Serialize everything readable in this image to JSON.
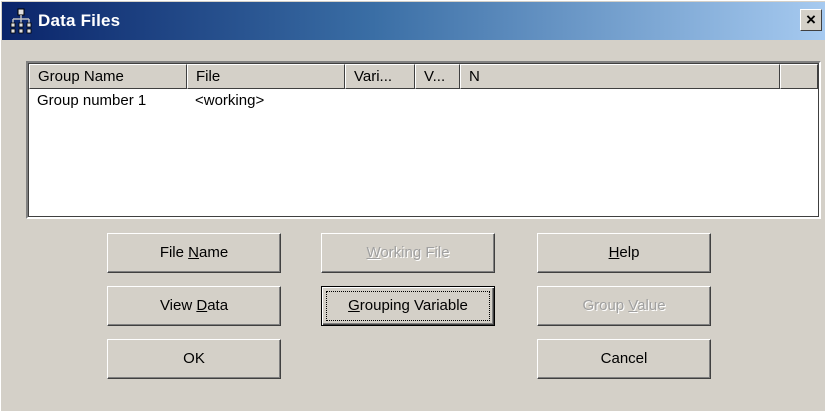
{
  "window": {
    "title": "Data Files",
    "close_label": "×"
  },
  "icons": {
    "app": "network-tree-icon",
    "close": "close-icon"
  },
  "list": {
    "columns": [
      "Group Name",
      "File",
      "Vari...",
      "V...",
      "N",
      ""
    ],
    "rows": [
      [
        "Group number 1",
        "<working>",
        "",
        "",
        "",
        ""
      ]
    ]
  },
  "buttons": {
    "file_name": {
      "pre": "File ",
      "mnemonic": "N",
      "post": "ame",
      "enabled": true
    },
    "working_file": {
      "pre": "",
      "mnemonic": "W",
      "post": "orking File",
      "enabled": false
    },
    "help": {
      "pre": "",
      "mnemonic": "H",
      "post": "elp",
      "enabled": true
    },
    "view_data": {
      "pre": "View ",
      "mnemonic": "D",
      "post": "ata",
      "enabled": true
    },
    "grouping_variable": {
      "pre": "",
      "mnemonic": "G",
      "post": "rouping Variable",
      "enabled": true,
      "focused": true
    },
    "group_value": {
      "pre": "Group ",
      "mnemonic": "V",
      "post": "alue",
      "enabled": false
    },
    "ok": {
      "label": "OK",
      "enabled": true
    },
    "cancel": {
      "label": "Cancel",
      "enabled": true
    }
  }
}
